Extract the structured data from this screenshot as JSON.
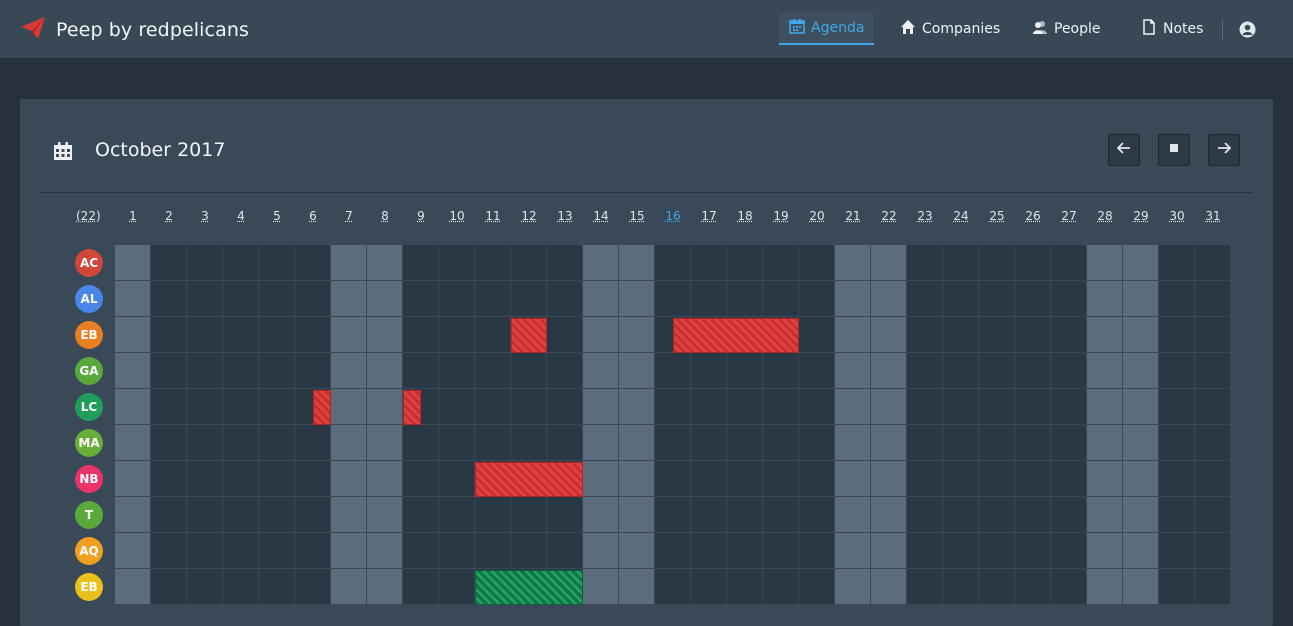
{
  "app": {
    "title": "Peep by redpelicans"
  },
  "nav": {
    "agenda": "Agenda",
    "companies": "Companies",
    "people": "People",
    "notes": "Notes"
  },
  "calendar": {
    "month_title": "October 2017",
    "count_label": "(22)",
    "today": 16,
    "days": [
      "1",
      "2",
      "3",
      "4",
      "5",
      "6",
      "7",
      "8",
      "9",
      "10",
      "11",
      "12",
      "13",
      "14",
      "15",
      "16",
      "17",
      "18",
      "19",
      "20",
      "21",
      "22",
      "23",
      "24",
      "25",
      "26",
      "27",
      "28",
      "29",
      "30",
      "31"
    ],
    "weekends": [
      1,
      7,
      8,
      14,
      15,
      21,
      22,
      28,
      29
    ],
    "people": [
      {
        "initials": "AC",
        "color": "#d0473a"
      },
      {
        "initials": "AL",
        "color": "#4a86e8"
      },
      {
        "initials": "EB",
        "color": "#e67e22"
      },
      {
        "initials": "GA",
        "color": "#5aa83b"
      },
      {
        "initials": "LC",
        "color": "#1e9e5a"
      },
      {
        "initials": "MA",
        "color": "#6aae3a"
      },
      {
        "initials": "NB",
        "color": "#e8336b"
      },
      {
        "initials": "T",
        "color": "#5aa83b"
      },
      {
        "initials": "AQ",
        "color": "#f0a020"
      },
      {
        "initials": "EB",
        "color": "#e9c11a"
      }
    ],
    "events": [
      {
        "row": 2,
        "start": 12,
        "end": 12,
        "kind": "absence"
      },
      {
        "row": 2,
        "start": 16,
        "end": 19,
        "kind": "absence",
        "half_start": "pm"
      },
      {
        "row": 4,
        "start": 6,
        "end": 6,
        "kind": "absence",
        "half": "pm"
      },
      {
        "row": 4,
        "start": 9,
        "end": 9,
        "kind": "absence",
        "half": "am"
      },
      {
        "row": 6,
        "start": 11,
        "end": 13,
        "kind": "absence"
      },
      {
        "row": 9,
        "start": 11,
        "end": 13,
        "kind": "present"
      }
    ]
  },
  "colors": {
    "accent": "#3fa7e6",
    "absence": "#d93a3a",
    "present": "#17874f",
    "weekend": "#5b6d7c"
  }
}
